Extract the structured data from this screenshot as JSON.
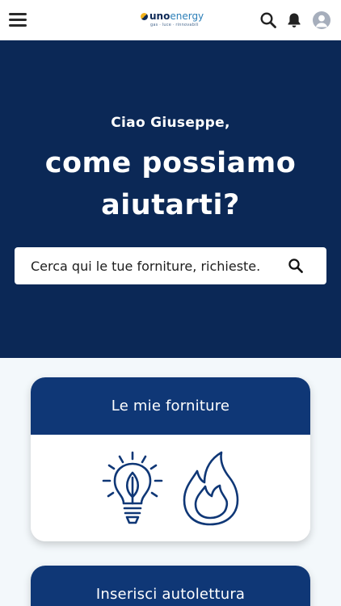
{
  "brand": {
    "name_part1": "uno",
    "name_part2": "energy",
    "tagline": "gas · luce · rinnovabili"
  },
  "header": {
    "menu_icon": "hamburger-menu-icon",
    "search_icon": "search-icon",
    "notification_icon": "bell-icon",
    "avatar_icon": "user-avatar-icon"
  },
  "hero": {
    "greeting": "Ciao Giuseppe,",
    "headline_line1": "come possiamo",
    "headline_line2": "aiutarti?",
    "search_placeholder": "Cerca qui le tue forniture, richieste.",
    "search_value": ""
  },
  "cards": [
    {
      "title": "Le mie forniture",
      "icons": [
        "lightbulb-leaf-icon",
        "flame-icon"
      ]
    },
    {
      "title": "Inserisci autolettura"
    }
  ],
  "colors": {
    "hero_background": "#0b2856",
    "card_header": "#0f3776",
    "page_background": "#f3f8fb",
    "accent_yellow": "#f2b21c"
  }
}
